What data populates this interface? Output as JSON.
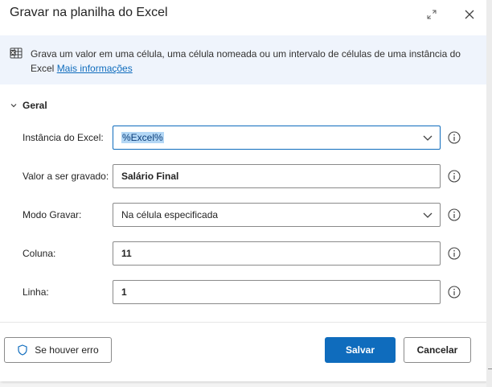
{
  "dialog": {
    "title": "Gravar na planilha do Excel",
    "expand_icon": "expand-icon",
    "close_icon": "close-icon"
  },
  "info": {
    "icon": "excel-icon",
    "text": "Grava um valor em uma célula, uma célula nomeada ou um intervalo de células de uma instância do Excel",
    "link_label": "Mais informações"
  },
  "section": {
    "label": "Geral",
    "toggle_icon": "chevron-down-icon"
  },
  "fields": {
    "instance": {
      "label": "Instância do Excel:",
      "value": "%Excel%"
    },
    "value": {
      "label": "Valor a ser gravado:",
      "value": "Salário Final"
    },
    "mode": {
      "label": "Modo Gravar:",
      "value": "Na célula especificada"
    },
    "column": {
      "label": "Coluna:",
      "value": "11"
    },
    "row": {
      "label": "Linha:",
      "value": "1"
    }
  },
  "footer": {
    "on_error_label": "Se houver erro",
    "on_error_icon": "shield-icon",
    "save_label": "Salvar",
    "cancel_label": "Cancelar"
  },
  "colors": {
    "accent": "#0f6cbd",
    "info_bg": "#eff4fc",
    "selection": "#b3d7f5"
  }
}
